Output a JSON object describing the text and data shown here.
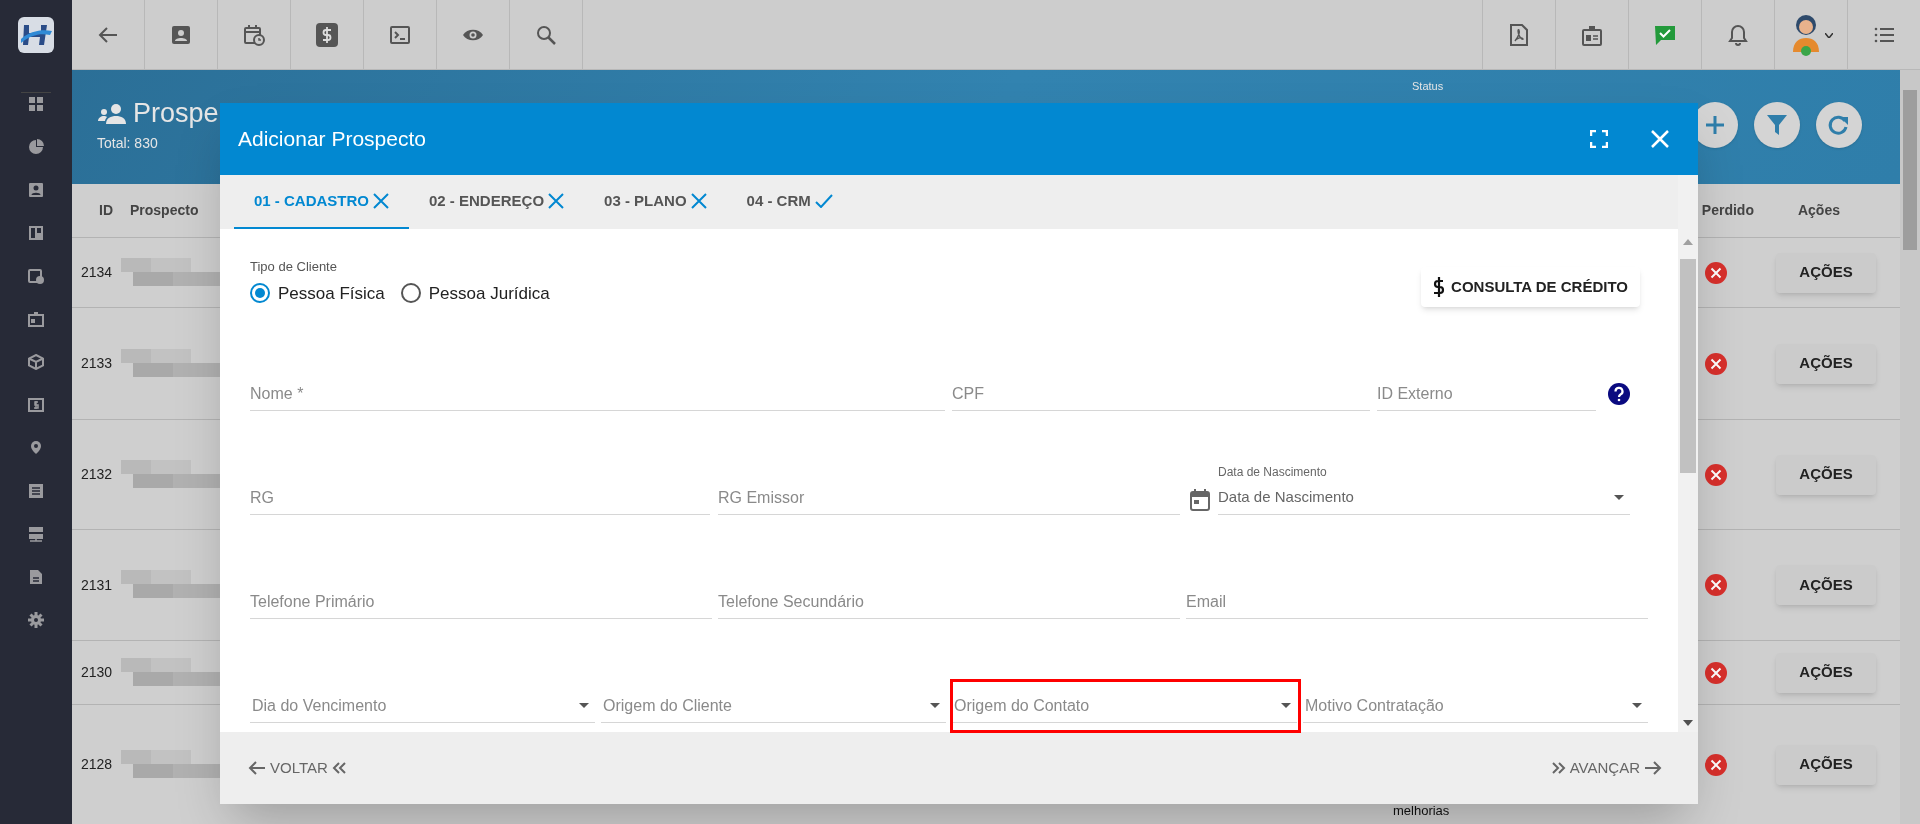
{
  "page": {
    "title": "Prospe",
    "total": "Total: 830",
    "status_label": "Status"
  },
  "table": {
    "columns": [
      "ID",
      "Prospecto",
      "Perdido",
      "Ações"
    ],
    "rows": [
      {
        "id": "2134",
        "action": "AÇÕES"
      },
      {
        "id": "2133",
        "action": "AÇÕES"
      },
      {
        "id": "2132",
        "action": "AÇÕES"
      },
      {
        "id": "2131",
        "action": "AÇÕES"
      },
      {
        "id": "2130",
        "action": "AÇÕES"
      },
      {
        "id": "2128",
        "action": "AÇÕES",
        "status": "melhorias"
      }
    ]
  },
  "modal": {
    "title": "Adicionar Prospecto",
    "tabs": [
      {
        "label": "01 - CADASTRO",
        "selected": true,
        "complete": false
      },
      {
        "label": "02 - ENDEREÇO",
        "selected": false,
        "complete": false
      },
      {
        "label": "03 - PLANO",
        "selected": false,
        "complete": false
      },
      {
        "label": "04 - CRM",
        "selected": false,
        "complete": true
      }
    ],
    "client_type": {
      "label": "Tipo de Cliente",
      "options": [
        {
          "label": "Pessoa Física",
          "selected": true
        },
        {
          "label": "Pessoa Jurídica",
          "selected": false
        }
      ]
    },
    "credit_button": "CONSULTA DE CRÉDITO",
    "field_rows": [
      [
        {
          "kind": "text",
          "placeholder": "Nome *"
        },
        {
          "kind": "text",
          "placeholder": "CPF"
        },
        {
          "kind": "text",
          "placeholder": "ID Externo",
          "help": true
        }
      ],
      [
        {
          "kind": "text",
          "placeholder": "RG"
        },
        {
          "kind": "text",
          "placeholder": "RG Emissor"
        },
        {
          "kind": "date",
          "label": "Data de Nascimento",
          "placeholder": "Data de Nascimento"
        }
      ],
      [
        {
          "kind": "text",
          "placeholder": "Telefone Primário"
        },
        {
          "kind": "text",
          "placeholder": "Telefone Secundário"
        },
        {
          "kind": "text",
          "placeholder": "Email"
        }
      ],
      [
        {
          "kind": "select",
          "placeholder": "Dia do Vencimento"
        },
        {
          "kind": "select",
          "placeholder": "Origem do Cliente"
        },
        {
          "kind": "select",
          "placeholder": "Origem do Contato",
          "highlighted": true
        },
        {
          "kind": "select",
          "placeholder": "Motivo Contratação"
        }
      ]
    ],
    "back_button": "VOLTAR",
    "next_button": "AVANÇAR"
  }
}
